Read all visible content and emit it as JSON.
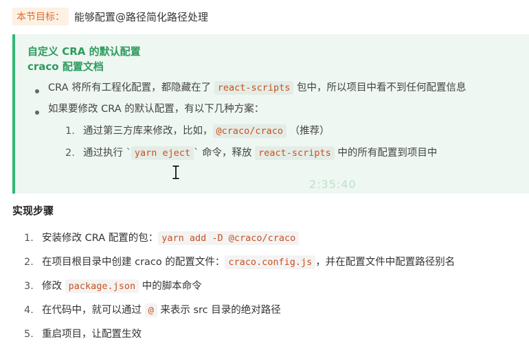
{
  "goal": {
    "label": "本节目标：",
    "text": "能够配置@路径简化路径处理"
  },
  "tip": {
    "link1": "自定义 CRA 的默认配置",
    "link2": "craco 配置文档",
    "bullets": [
      {
        "before": "CRA 将所有工程化配置，都隐藏在了 ",
        "code": "react-scripts",
        "after": " 包中，所以项目中看不到任何配置信息"
      },
      {
        "text": "如果要修改 CRA 的默认配置，有以下几种方案："
      }
    ],
    "options": [
      {
        "num": "1.",
        "before": "通过第三方库来修改，比如，",
        "code": "@craco/craco",
        "after": " （推荐）"
      },
      {
        "num": "2.",
        "before": "通过执行 `",
        "code": "yarn eject",
        "mid": "` 命令，释放 ",
        "code2": "react-scripts",
        "after": " 中的所有配置到项目中"
      }
    ]
  },
  "timestamp": "2:35:40",
  "steps_title": "实现步骤",
  "steps": [
    {
      "num": "1.",
      "before": "安装修改 CRA 配置的包：",
      "code": "yarn add -D @craco/craco",
      "after": ""
    },
    {
      "num": "2.",
      "before": "在项目根目录中创建 craco 的配置文件：",
      "code": "craco.config.js",
      "after": "，并在配置文件中配置路径别名"
    },
    {
      "num": "3.",
      "before": "修改 ",
      "code": "package.json",
      "after": " 中的脚本命令"
    },
    {
      "num": "4.",
      "before": "在代码中，就可以通过 ",
      "code": "@",
      "after": " 来表示 src 目录的绝对路径"
    },
    {
      "num": "5.",
      "before": "重启项目，让配置生效",
      "code": "",
      "after": ""
    }
  ],
  "colors": {
    "accent_green": "#2fb873",
    "code_text": "#c7511f",
    "goal_label": "#e06c2c"
  },
  "icons": {
    "cursor": "text-cursor-icon"
  }
}
